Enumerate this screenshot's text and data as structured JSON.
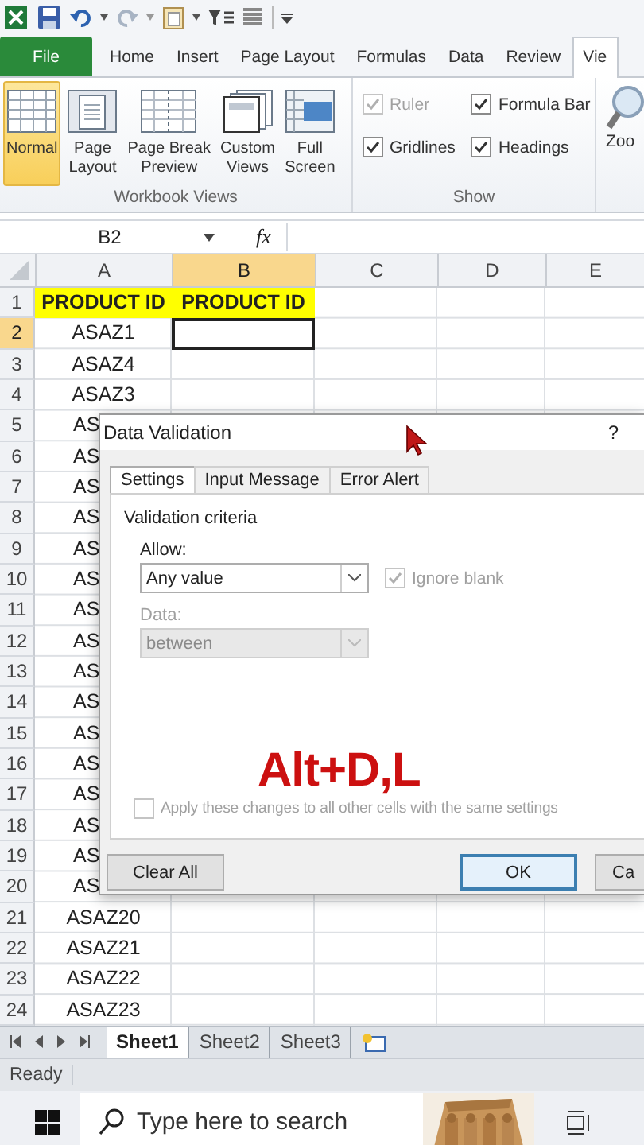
{
  "ribbon_tabs": [
    {
      "label": "File",
      "kind": "file",
      "selected": false
    },
    {
      "label": "Home",
      "kind": "tab",
      "selected": false
    },
    {
      "label": "Insert",
      "kind": "tab",
      "selected": false
    },
    {
      "label": "Page Layout",
      "kind": "tab",
      "selected": false
    },
    {
      "label": "Formulas",
      "kind": "tab",
      "selected": false
    },
    {
      "label": "Data",
      "kind": "tab",
      "selected": false
    },
    {
      "label": "Review",
      "kind": "tab",
      "selected": false
    },
    {
      "label": "Vie",
      "kind": "tab",
      "selected": true
    }
  ],
  "workbook_views": {
    "title": "Workbook Views",
    "buttons": [
      {
        "lines": [
          "Normal"
        ],
        "kind": "normal",
        "selected": true
      },
      {
        "lines": [
          "Page",
          "Layout"
        ],
        "kind": "page",
        "selected": false
      },
      {
        "lines": [
          "Page Break",
          "Preview"
        ],
        "kind": "break",
        "selected": false
      },
      {
        "lines": [
          "Custom",
          "Views"
        ],
        "kind": "custom",
        "selected": false
      },
      {
        "lines": [
          "Full",
          "Screen"
        ],
        "kind": "full",
        "selected": false
      }
    ]
  },
  "show": {
    "title": "Show",
    "options": [
      {
        "label": "Ruler",
        "checked": true,
        "disabled": true
      },
      {
        "label": "Formula Bar",
        "checked": true,
        "disabled": false
      },
      {
        "label": "Gridlines",
        "checked": true,
        "disabled": false
      },
      {
        "label": "Headings",
        "checked": true,
        "disabled": false
      }
    ]
  },
  "zoom": {
    "label": "Zoo"
  },
  "formula_bar": {
    "name_box": "B2",
    "fx": "fx"
  },
  "columns": [
    {
      "label": "A",
      "selected": false
    },
    {
      "label": "B",
      "selected": true
    },
    {
      "label": "C",
      "selected": false
    },
    {
      "label": "D",
      "selected": false
    },
    {
      "label": "E",
      "selected": false
    }
  ],
  "rows": [
    {
      "header": "1",
      "selected": false,
      "cells": [
        {
          "text": "PRODUCT ID",
          "highlighted": true,
          "clipped": false,
          "selected": false
        },
        {
          "text": "PRODUCT ID",
          "highlighted": true,
          "clipped": false,
          "selected": false
        }
      ]
    },
    {
      "header": "2",
      "selected": true,
      "cells": [
        {
          "text": "ASAZ1",
          "highlighted": false,
          "clipped": false,
          "selected": false
        },
        {
          "highlighted": false,
          "clipped": false,
          "selected": true
        }
      ]
    },
    {
      "header": "3",
      "selected": false,
      "cells": [
        {
          "text": "ASAZ4",
          "highlighted": false,
          "clipped": false,
          "selected": false
        }
      ]
    },
    {
      "header": "4",
      "selected": false,
      "cells": [
        {
          "text": "ASAZ3",
          "highlighted": false,
          "clipped": false,
          "selected": false
        }
      ]
    },
    {
      "header": "5",
      "selected": false,
      "cells": [
        {
          "text": "AS",
          "highlighted": false,
          "clipped": true,
          "selected": false
        }
      ]
    },
    {
      "header": "6",
      "selected": false,
      "cells": [
        {
          "text": "AS",
          "highlighted": false,
          "clipped": true,
          "selected": false
        }
      ]
    },
    {
      "header": "7",
      "selected": false,
      "cells": [
        {
          "text": "AS",
          "highlighted": false,
          "clipped": true,
          "selected": false
        }
      ]
    },
    {
      "header": "8",
      "selected": false,
      "cells": [
        {
          "text": "AS",
          "highlighted": false,
          "clipped": true,
          "selected": false
        }
      ]
    },
    {
      "header": "9",
      "selected": false,
      "cells": [
        {
          "text": "AS",
          "highlighted": false,
          "clipped": true,
          "selected": false
        }
      ]
    },
    {
      "header": "10",
      "selected": false,
      "cells": [
        {
          "text": "AS",
          "highlighted": false,
          "clipped": true,
          "selected": false
        }
      ]
    },
    {
      "header": "11",
      "selected": false,
      "cells": [
        {
          "text": "AS",
          "highlighted": false,
          "clipped": true,
          "selected": false
        }
      ]
    },
    {
      "header": "12",
      "selected": false,
      "cells": [
        {
          "text": "AS",
          "highlighted": false,
          "clipped": true,
          "selected": false
        }
      ]
    },
    {
      "header": "13",
      "selected": false,
      "cells": [
        {
          "text": "AS",
          "highlighted": false,
          "clipped": true,
          "selected": false
        }
      ]
    },
    {
      "header": "14",
      "selected": false,
      "cells": [
        {
          "text": "AS",
          "highlighted": false,
          "clipped": true,
          "selected": false
        }
      ]
    },
    {
      "header": "15",
      "selected": false,
      "cells": [
        {
          "text": "AS",
          "highlighted": false,
          "clipped": true,
          "selected": false
        }
      ]
    },
    {
      "header": "16",
      "selected": false,
      "cells": [
        {
          "text": "AS",
          "highlighted": false,
          "clipped": true,
          "selected": false
        }
      ]
    },
    {
      "header": "17",
      "selected": false,
      "cells": [
        {
          "text": "AS",
          "highlighted": false,
          "clipped": true,
          "selected": false
        }
      ]
    },
    {
      "header": "18",
      "selected": false,
      "cells": [
        {
          "text": "AS",
          "highlighted": false,
          "clipped": true,
          "selected": false
        }
      ]
    },
    {
      "header": "19",
      "selected": false,
      "cells": [
        {
          "text": "AS",
          "highlighted": false,
          "clipped": true,
          "selected": false
        }
      ]
    },
    {
      "header": "20",
      "selected": false,
      "cells": [
        {
          "text": "AS",
          "highlighted": false,
          "clipped": true,
          "selected": false
        }
      ]
    },
    {
      "header": "21",
      "selected": false,
      "cells": [
        {
          "text": "ASAZ20",
          "highlighted": false,
          "clipped": false,
          "selected": false
        }
      ]
    },
    {
      "header": "22",
      "selected": false,
      "cells": [
        {
          "text": "ASAZ21",
          "highlighted": false,
          "clipped": false,
          "selected": false
        }
      ]
    },
    {
      "header": "23",
      "selected": false,
      "cells": [
        {
          "text": "ASAZ22",
          "highlighted": false,
          "clipped": false,
          "selected": false
        }
      ]
    },
    {
      "header": "24",
      "selected": false,
      "cells": [
        {
          "text": "ASAZ23",
          "highlighted": false,
          "clipped": false,
          "selected": false
        }
      ]
    }
  ],
  "dialog": {
    "title": "Data Validation",
    "help": "?",
    "tabs": [
      {
        "label": "Settings",
        "selected": true
      },
      {
        "label": "Input Message",
        "selected": false
      },
      {
        "label": "Error Alert",
        "selected": false
      }
    ],
    "group_title": "Validation criteria",
    "allow_label": "Allow:",
    "allow_value": "Any value",
    "ignore_blank": {
      "label": "Ignore blank",
      "checked": true,
      "disabled": true
    },
    "data_label": "Data:",
    "data_value": "between",
    "data_disabled": true,
    "apply_all": {
      "label": "Apply these changes to all other cells with the same settings",
      "checked": false,
      "disabled": true
    },
    "buttons": [
      {
        "label": "Clear All",
        "kind": "left"
      },
      {
        "label": "OK",
        "kind": "default"
      },
      {
        "label": "Ca",
        "kind": "right"
      }
    ]
  },
  "caption": "Alt+D,L",
  "sheet_tabs": [
    {
      "label": "Sheet1",
      "selected": true
    },
    {
      "label": "Sheet2",
      "selected": false
    },
    {
      "label": "Sheet3",
      "selected": false
    }
  ],
  "status_bar": {
    "text": "Ready"
  },
  "taskbar": {
    "search_placeholder": "Type here to search"
  }
}
